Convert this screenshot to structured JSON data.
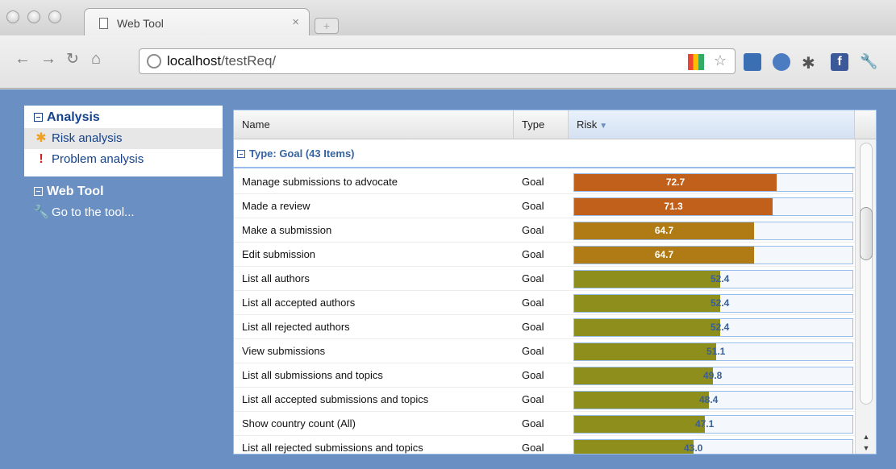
{
  "browser": {
    "tab_title": "Web Tool",
    "tab_close": "×",
    "address": {
      "host": "localhost",
      "path": "/testReq/"
    }
  },
  "sidebar": {
    "analysis": {
      "title": "Analysis",
      "items": [
        {
          "label": "Risk analysis",
          "icon": "asterisk-icon"
        },
        {
          "label": "Problem analysis",
          "icon": "exclamation-icon"
        }
      ]
    },
    "webtool": {
      "title": "Web Tool",
      "items": [
        {
          "label": "Go to the tool...",
          "icon": "wrench-icon"
        }
      ]
    }
  },
  "grid": {
    "columns": [
      "Name",
      "Type",
      "Risk"
    ],
    "group_label": "Type: Goal (43 Items)",
    "rows": [
      {
        "name": "Manage submissions to advocate",
        "type": "Goal",
        "risk": 72.7,
        "risk_label": "72.7"
      },
      {
        "name": "Made a review",
        "type": "Goal",
        "risk": 71.3,
        "risk_label": "71.3"
      },
      {
        "name": "Make a submission",
        "type": "Goal",
        "risk": 64.7,
        "risk_label": "64.7"
      },
      {
        "name": "Edit submission",
        "type": "Goal",
        "risk": 64.7,
        "risk_label": "64.7"
      },
      {
        "name": "List all authors",
        "type": "Goal",
        "risk": 52.4,
        "risk_label": "52.4"
      },
      {
        "name": "List all accepted authors",
        "type": "Goal",
        "risk": 52.4,
        "risk_label": "52.4"
      },
      {
        "name": "List all rejected authors",
        "type": "Goal",
        "risk": 52.4,
        "risk_label": "52.4"
      },
      {
        "name": "View submissions",
        "type": "Goal",
        "risk": 51.1,
        "risk_label": "51.1"
      },
      {
        "name": "List all submissions and topics",
        "type": "Goal",
        "risk": 49.8,
        "risk_label": "49.8"
      },
      {
        "name": "List all accepted submissions and topics",
        "type": "Goal",
        "risk": 48.4,
        "risk_label": "48.4"
      },
      {
        "name": "Show country count (All)",
        "type": "Goal",
        "risk": 47.1,
        "risk_label": "47.1"
      },
      {
        "name": "List all rejected submissions and topics",
        "type": "Goal",
        "risk": 43.0,
        "risk_label": "43.0"
      }
    ],
    "colors": {
      "high": "#c0601a",
      "mid": "#b07a14",
      "low": "#8e8e1c"
    }
  }
}
